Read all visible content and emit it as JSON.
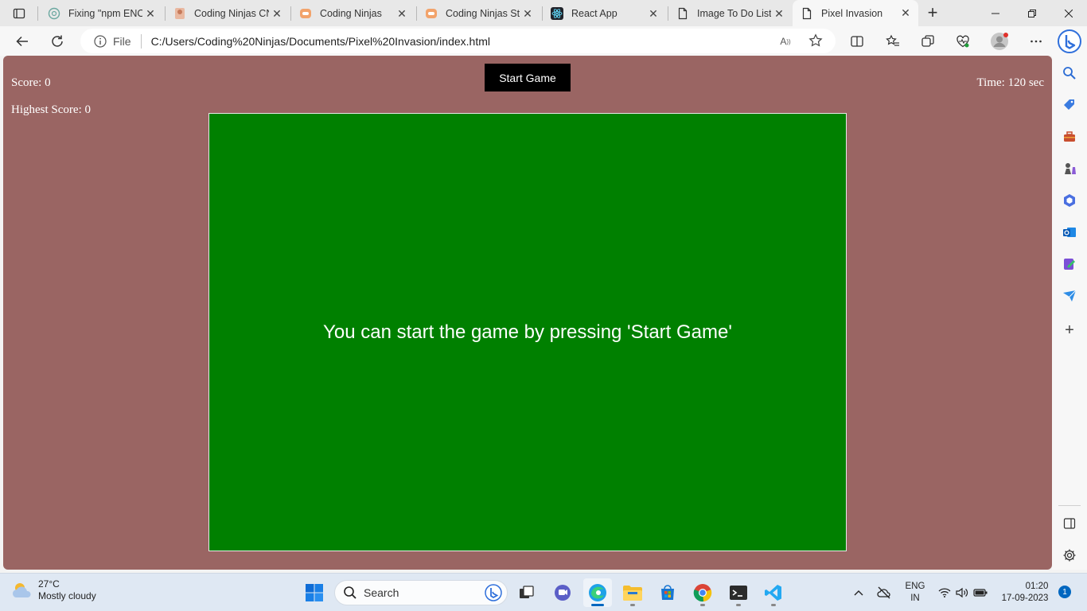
{
  "browser": {
    "tabs": [
      {
        "title": "Fixing \"npm ENOI",
        "icon": "chatgpt-icon",
        "active": false
      },
      {
        "title": "Coding Ninjas CN",
        "icon": "coding-ninjas-icon",
        "active": false
      },
      {
        "title": "Coding Ninjas",
        "icon": "coding-ninjas-icon",
        "active": false
      },
      {
        "title": "Coding Ninjas Stu",
        "icon": "coding-ninjas-icon",
        "active": false
      },
      {
        "title": "React App",
        "icon": "react-icon",
        "active": false
      },
      {
        "title": "Image To Do List",
        "icon": "page-icon",
        "active": false
      },
      {
        "title": "Pixel Invasion",
        "icon": "page-icon",
        "active": true
      }
    ],
    "address": {
      "scheme_label": "File",
      "url": "C:/Users/Coding%20Ninjas/Documents/Pixel%20Invasion/index.html"
    }
  },
  "game": {
    "score_text": "Score: 0",
    "highest_score_text": "Highest Score: 0",
    "time_text": "Time: 120 sec",
    "start_button_label": "Start Game",
    "board_message": "You can start the game by pressing 'Start Game'",
    "colors": {
      "page_bg": "#9a6563",
      "board_bg": "#008000",
      "button_bg": "#000000"
    }
  },
  "taskbar": {
    "weather_temp": "27°C",
    "weather_desc": "Mostly cloudy",
    "search_label": "Search",
    "lang_line1": "ENG",
    "lang_line2": "IN",
    "time": "01:20",
    "date": "17-09-2023",
    "notification_count": "1"
  }
}
